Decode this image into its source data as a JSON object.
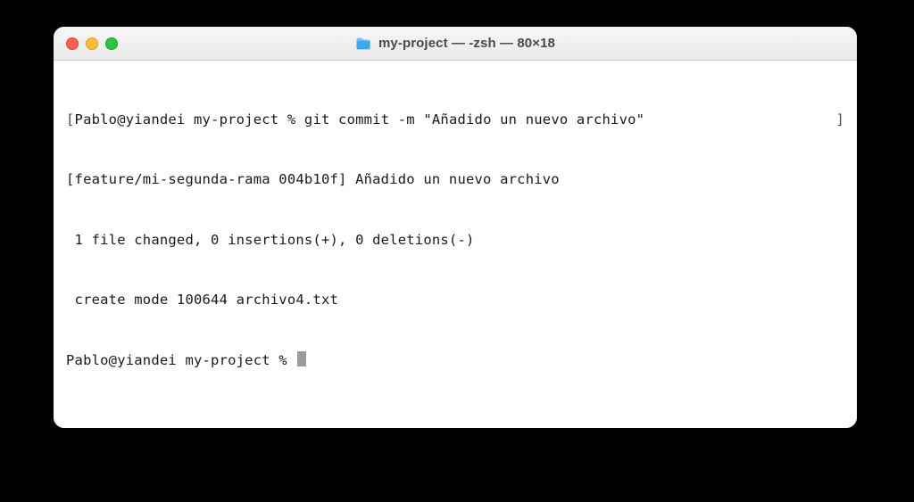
{
  "window": {
    "title": "my-project — -zsh — 80×18"
  },
  "terminal": {
    "lines": [
      {
        "leftBracket": "[",
        "prompt": "Pablo@yiandei my-project % ",
        "command": "git commit -m \"Añadido un nuevo archivo\"",
        "rightBracket": "]"
      },
      {
        "text": "[feature/mi-segunda-rama 004b10f] Añadido un nuevo archivo"
      },
      {
        "text": " 1 file changed, 0 insertions(+), 0 deletions(-)"
      },
      {
        "text": " create mode 100644 archivo4.txt"
      }
    ],
    "currentPrompt": "Pablo@yiandei my-project % "
  }
}
